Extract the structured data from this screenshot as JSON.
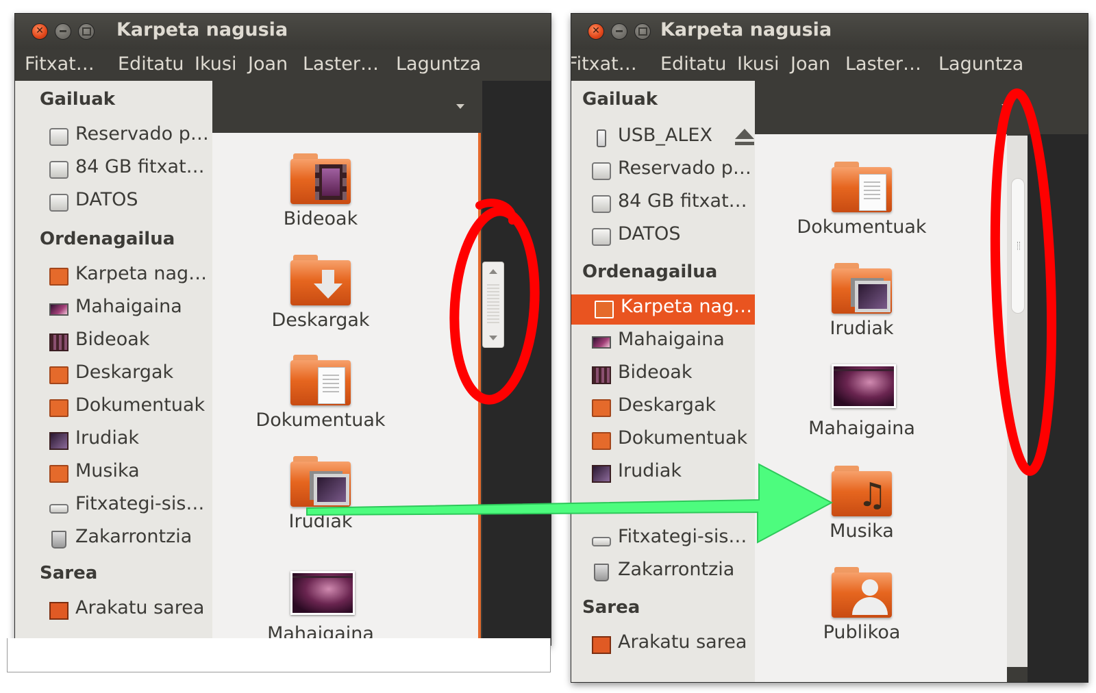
{
  "left_window": {
    "title": "Karpeta nagusia",
    "menu": [
      "Fitxat…",
      "Editatu",
      "Ikusi",
      "Joan",
      "Laster…",
      "Laguntza"
    ],
    "sidebar": {
      "devices_header": "Gailuak",
      "devices": [
        {
          "label": "Reservado p…",
          "icon": "drive-icon"
        },
        {
          "label": "84 GB fitxat…",
          "icon": "drive-icon"
        },
        {
          "label": "DATOS",
          "icon": "drive-icon"
        }
      ],
      "computer_header": "Ordenagailua",
      "computer": [
        {
          "label": "Karpeta nag…",
          "icon": "home-folder-icon"
        },
        {
          "label": "Mahaigaina",
          "icon": "desktop-icon"
        },
        {
          "label": "Bideoak",
          "icon": "videos-icon"
        },
        {
          "label": "Deskargak",
          "icon": "downloads-folder-icon"
        },
        {
          "label": "Dokumentuak",
          "icon": "documents-folder-icon"
        },
        {
          "label": "Irudiak",
          "icon": "pictures-icon"
        },
        {
          "label": "Musika",
          "icon": "music-folder-icon"
        },
        {
          "label": "Fitxategi-sis…",
          "icon": "filesystem-icon"
        },
        {
          "label": "Zakarrontzia",
          "icon": "trash-icon"
        }
      ],
      "network_header": "Sarea",
      "network": [
        {
          "label": "Arakatu sarea",
          "icon": "network-icon"
        }
      ]
    },
    "files": [
      {
        "label": "Bideoak",
        "icon": "videos-folder-icon"
      },
      {
        "label": "Deskargak",
        "icon": "downloads-folder-icon"
      },
      {
        "label": "Dokumentuak",
        "icon": "documents-folder-icon"
      },
      {
        "label": "Irudiak",
        "icon": "pictures-folder-icon"
      },
      {
        "label": "Mahaigaina",
        "icon": "desktop-icon"
      }
    ]
  },
  "right_window": {
    "title": "Karpeta nagusia",
    "menu": [
      "Fitxat…",
      "Editatu",
      "Ikusi",
      "Joan",
      "Laster…",
      "Laguntza"
    ],
    "sidebar": {
      "devices_header": "Gailuak",
      "devices": [
        {
          "label": "USB_ALEX",
          "icon": "usb-drive-icon"
        },
        {
          "label": "Reservado p…",
          "icon": "drive-icon"
        },
        {
          "label": "84 GB fitxat…",
          "icon": "drive-icon"
        },
        {
          "label": "DATOS",
          "icon": "drive-icon"
        }
      ],
      "computer_header": "Ordenagailua",
      "computer": [
        {
          "label": "Karpeta nag…",
          "icon": "home-folder-icon",
          "selected": true
        },
        {
          "label": "Mahaigaina",
          "icon": "desktop-icon"
        },
        {
          "label": "Bideoak",
          "icon": "videos-icon"
        },
        {
          "label": "Deskargak",
          "icon": "downloads-folder-icon"
        },
        {
          "label": "Dokumentuak",
          "icon": "documents-folder-icon"
        },
        {
          "label": "Irudiak",
          "icon": "pictures-icon"
        },
        {
          "label": "Fitxategi-sis…",
          "icon": "filesystem-icon"
        },
        {
          "label": "Zakarrontzia",
          "icon": "trash-icon"
        }
      ],
      "network_header": "Sarea",
      "network": [
        {
          "label": "Arakatu sarea",
          "icon": "network-icon"
        }
      ]
    },
    "files": [
      {
        "label": "Dokumentuak",
        "icon": "documents-folder-icon"
      },
      {
        "label": "Irudiak",
        "icon": "pictures-folder-icon"
      },
      {
        "label": "Mahaigaina",
        "icon": "desktop-icon"
      },
      {
        "label": "Musika",
        "icon": "music-folder-icon"
      },
      {
        "label": "Publikoa",
        "icon": "public-folder-icon"
      }
    ]
  },
  "colors": {
    "accent": "#e95420",
    "annotation_circle": "#ff0000",
    "annotation_arrow": "#4dfc7e"
  }
}
